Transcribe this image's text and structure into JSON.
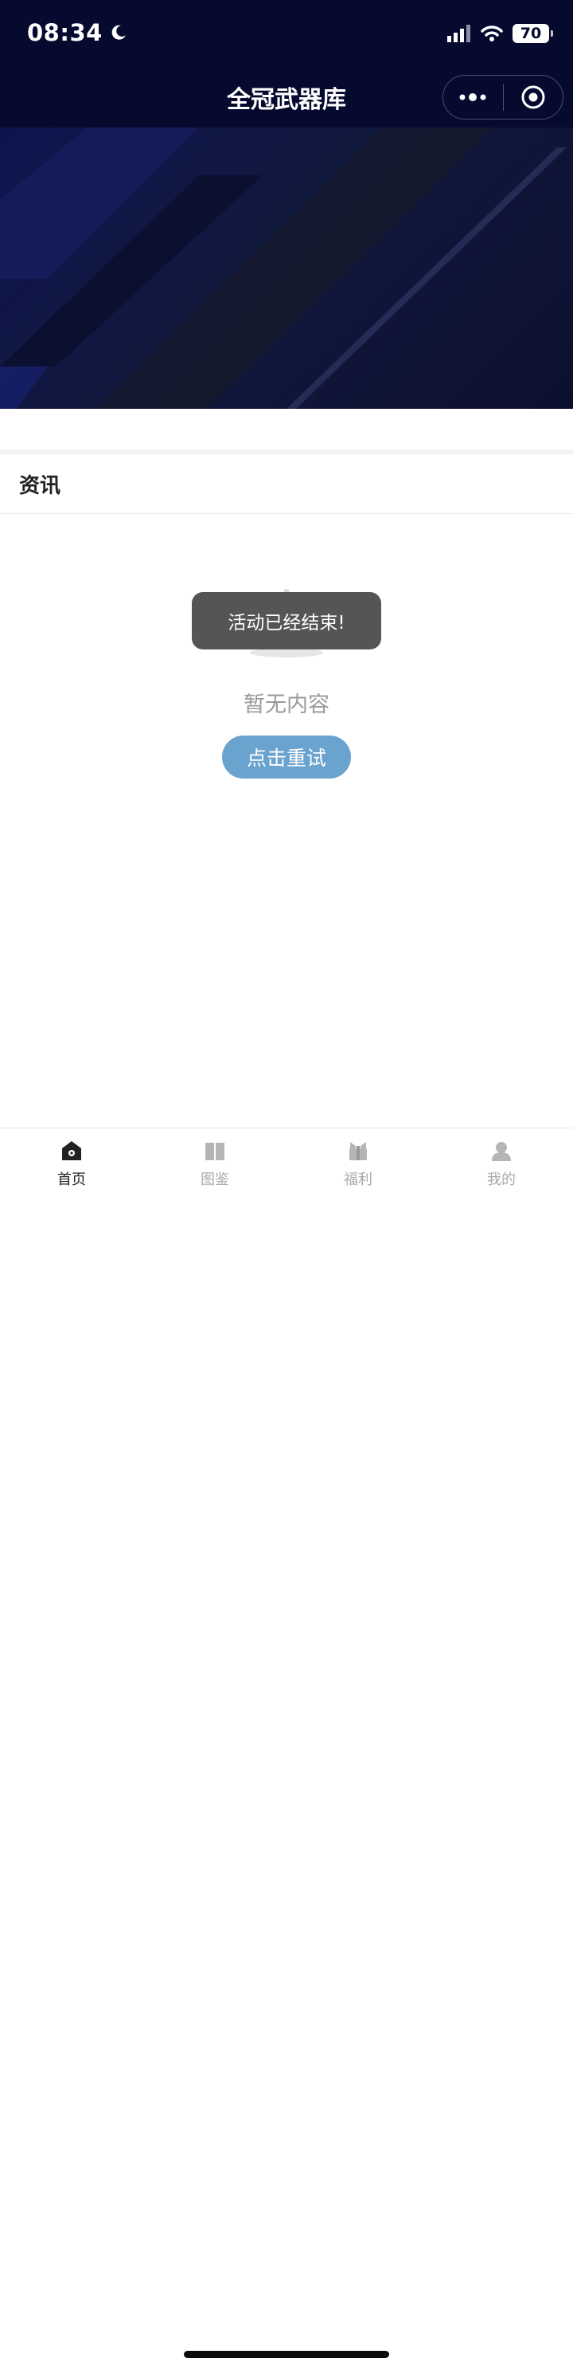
{
  "status_bar": {
    "time": "08:34",
    "battery": "70"
  },
  "nav": {
    "title": "全冠武器库"
  },
  "section": {
    "title": "资讯"
  },
  "empty_state": {
    "text": "暂无内容",
    "retry_label": "点击重试"
  },
  "toast": {
    "message": "活动已经结束!"
  },
  "tabbar": {
    "items": [
      {
        "label": "首页",
        "icon": "home-icon",
        "active": true
      },
      {
        "label": "图鉴",
        "icon": "book-icon",
        "active": false
      },
      {
        "label": "福利",
        "icon": "gift-icon",
        "active": false
      },
      {
        "label": "我的",
        "icon": "user-icon",
        "active": false
      }
    ]
  },
  "colors": {
    "topbar_bg": "#050a2e",
    "retry_button": "#6ba3cf",
    "tab_active": "#222222",
    "tab_inactive": "#aaaaaa"
  }
}
